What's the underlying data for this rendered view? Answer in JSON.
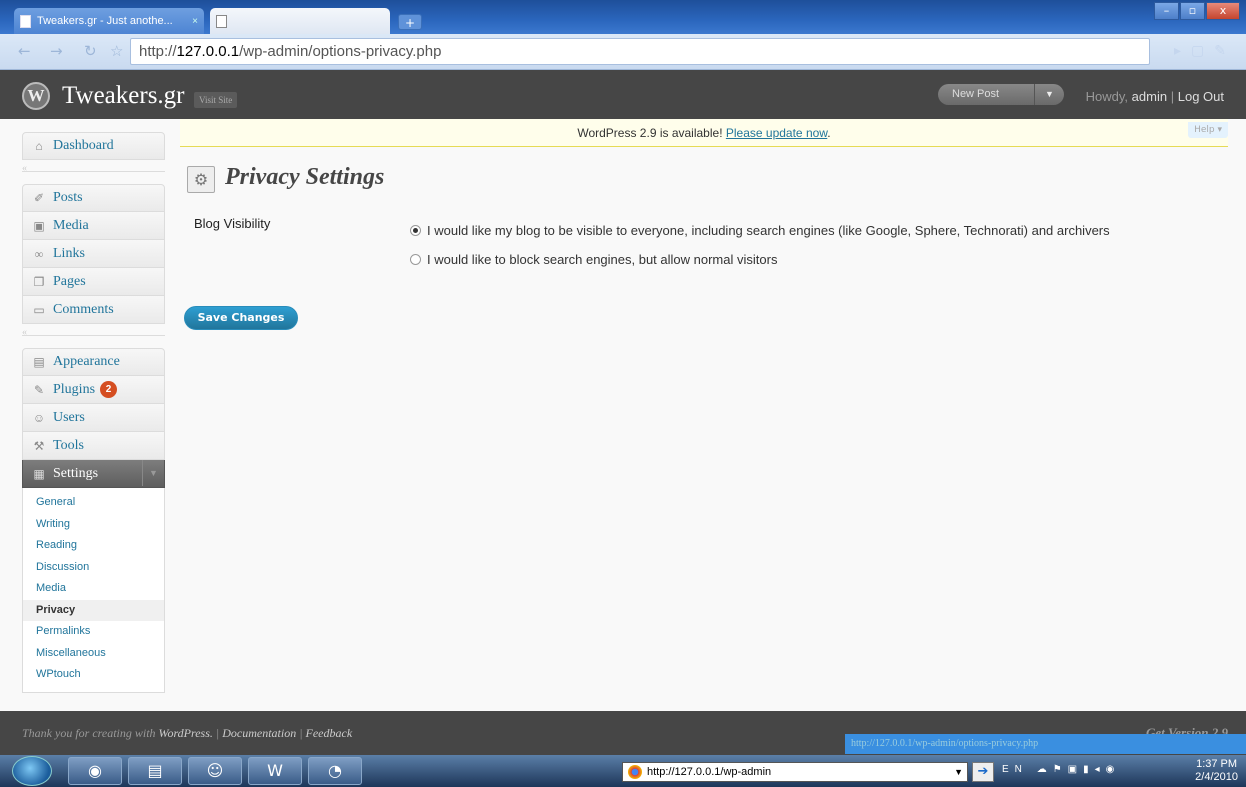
{
  "browser": {
    "tabs": [
      {
        "label": "Tweakers.gr - Just anothe...",
        "close": "×"
      },
      {
        "label": ""
      }
    ],
    "newtab": "+",
    "window_buttons": {
      "minimize": "–",
      "maximize": "▫",
      "close": "x"
    },
    "address_prefix": "http://",
    "address_host": "127.0.0.1",
    "address_path": "/wp-admin/options-privacy.php"
  },
  "header": {
    "site_title": "Tweakers.gr",
    "visit_site": "Visit Site",
    "new_post": "New Post",
    "howdy_prefix": "Howdy,",
    "username": "admin",
    "separator": "|",
    "logout": "Log Out"
  },
  "notice": {
    "text": "WordPress 2.9 is available!",
    "link": "Please update now",
    "period": "."
  },
  "help": "Help ▾",
  "sidebar": {
    "dashboard": "Dashboard",
    "posts": "Posts",
    "media": "Media",
    "links": "Links",
    "pages": "Pages",
    "comments": "Comments",
    "appearance": "Appearance",
    "plugins": "Plugins",
    "plugins_badge": "2",
    "users": "Users",
    "tools": "Tools",
    "settings": "Settings",
    "submenu": [
      "General",
      "Writing",
      "Reading",
      "Discussion",
      "Media",
      "Privacy",
      "Permalinks",
      "Miscellaneous",
      "WPtouch"
    ]
  },
  "page": {
    "title": "Privacy Settings",
    "field_label": "Blog Visibility",
    "option_visible": "I would like my blog to be visible to everyone, including search engines (like Google, Sphere, Technorati) and archivers",
    "option_block": "I would like to block search engines, but allow normal visitors",
    "selected_option": "option_visible",
    "save_button": "Save Changes"
  },
  "footer": {
    "thanks_prefix": "Thank you for creating with",
    "wordpress": "WordPress.",
    "documentation": "Documentation",
    "feedback": "Feedback",
    "version": "Get Version 2.9",
    "status_url": "http://127.0.0.1/wp-admin/options-privacy.php"
  },
  "taskbar": {
    "address": "http://127.0.0.1/wp-admin",
    "lang": "EN",
    "time": "1:37 PM",
    "date": "2/4/2010"
  },
  "colors": {
    "link": "#21759b",
    "header_bg": "#464646",
    "notice_bg": "#fffeeb",
    "badge": "#d54e21"
  }
}
